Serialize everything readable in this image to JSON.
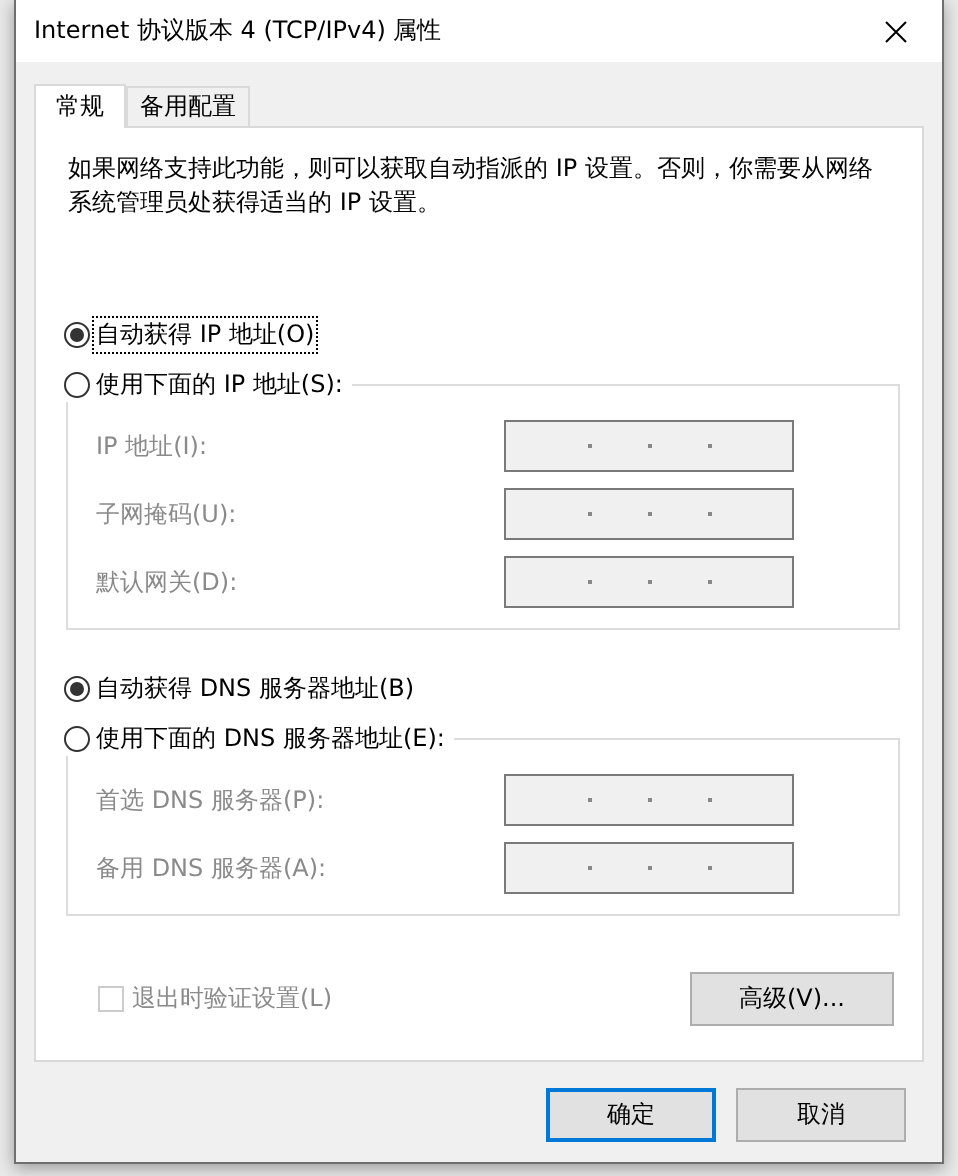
{
  "window": {
    "title": "Internet 协议版本 4 (TCP/IPv4) 属性"
  },
  "tabs": [
    {
      "label": "常规",
      "selected": true
    },
    {
      "label": "备用配置",
      "selected": false
    }
  ],
  "description": "如果网络支持此功能，则可以获取自动指派的 IP 设置。否则，你需要从网络系统管理员处获得适当的 IP 设置。",
  "groups": [
    {
      "auto_option": {
        "label": "自动获得 IP 地址(O)",
        "selected": true,
        "focused": true
      },
      "manual_option": {
        "label": "使用下面的 IP 地址(S):",
        "selected": false
      },
      "fields": [
        {
          "label": "IP 地址(I):",
          "disabled": true
        },
        {
          "label": "子网掩码(U):",
          "disabled": true
        },
        {
          "label": "默认网关(D):",
          "disabled": true
        }
      ]
    },
    {
      "auto_option": {
        "label": "自动获得 DNS 服务器地址(B)",
        "selected": true,
        "focused": false
      },
      "manual_option": {
        "label": "使用下面的 DNS 服务器地址(E):",
        "selected": false
      },
      "fields": [
        {
          "label": "首选 DNS 服务器(P):",
          "disabled": true
        },
        {
          "label": "备用 DNS 服务器(A):",
          "disabled": true
        }
      ]
    }
  ],
  "validate_checkbox": {
    "label": "退出时验证设置(L)",
    "checked": false,
    "disabled": true
  },
  "advanced_button": "高级(V)...",
  "buttons": [
    {
      "label": "确定",
      "default": true
    },
    {
      "label": "取消",
      "default": false
    }
  ]
}
